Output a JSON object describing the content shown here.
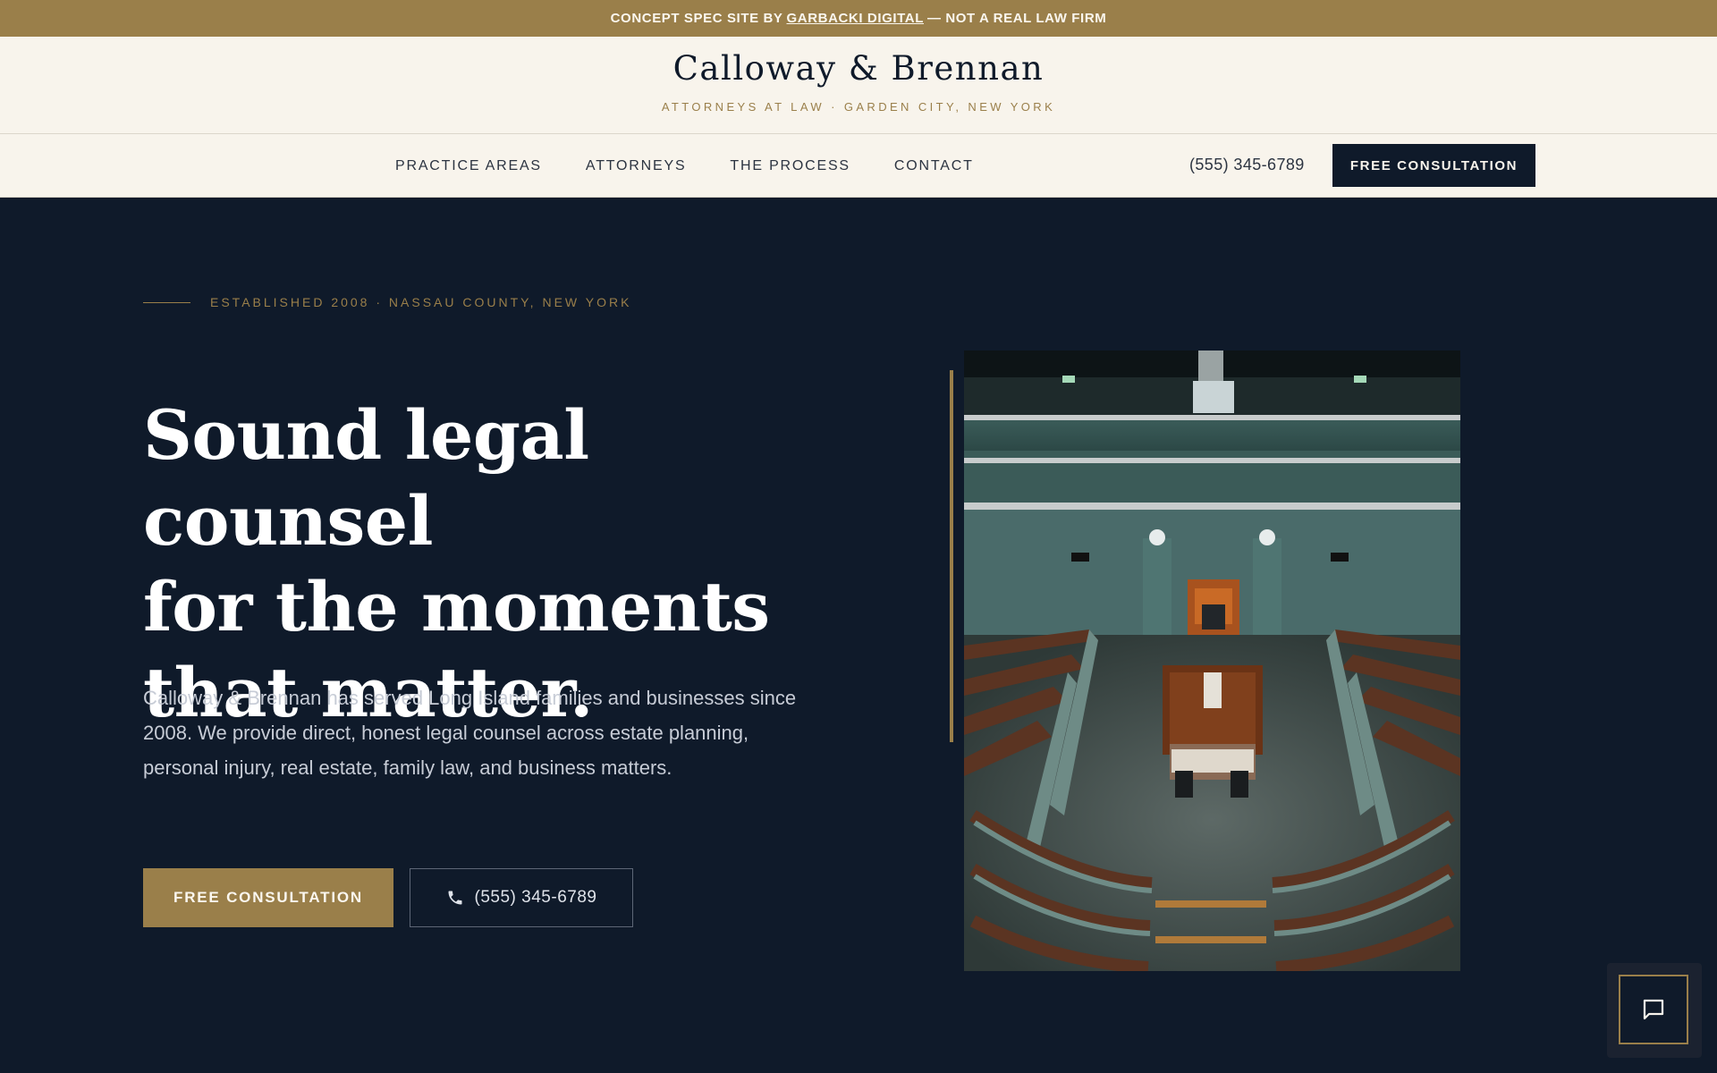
{
  "banner": {
    "prefix": "CONCEPT SPEC SITE BY",
    "link": "GARBACKI DIGITAL",
    "suffix": "— NOT A REAL LAW FIRM"
  },
  "header": {
    "brand": "Calloway & Brennan",
    "tagline": "ATTORNEYS AT LAW · GARDEN CITY, NEW YORK"
  },
  "nav": {
    "links": [
      "PRACTICE AREAS",
      "ATTORNEYS",
      "THE PROCESS",
      "CONTACT"
    ],
    "phone": "(555) 345-6789",
    "cta": "FREE CONSULTATION"
  },
  "hero": {
    "eyebrow": "ESTABLISHED 2008 · NASSAU COUNTY, NEW YORK",
    "headline": [
      "Sound legal counsel",
      "for the moments",
      "that matter."
    ],
    "lede": "Calloway & Brennan has served Long Island families and businesses since 2008. We provide direct, honest legal counsel across estate planning, personal injury, real estate, family law, and business matters.",
    "primary_cta": "FREE CONSULTATION",
    "phone_cta": "(555) 345-6789"
  },
  "icons": {
    "phone": "phone-icon",
    "chat": "chat-bubble-icon"
  },
  "colors": {
    "gold": "#9a7f4a",
    "navy": "#0f1a2a",
    "cream": "#f8f4ec"
  }
}
